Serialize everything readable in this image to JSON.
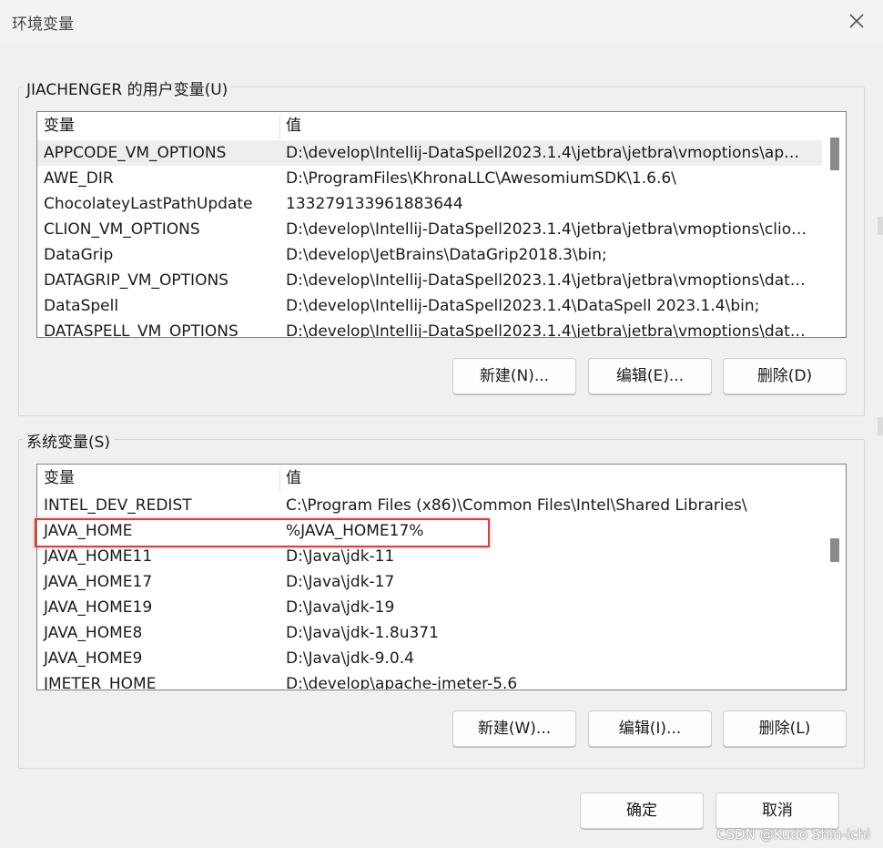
{
  "window": {
    "title": "环境变量"
  },
  "user_vars": {
    "label": "JIACHENGER 的用户变量(U)",
    "columns": {
      "name": "变量",
      "value": "值"
    },
    "rows": [
      {
        "name": "APPCODE_VM_OPTIONS",
        "value": "D:\\develop\\Intellij-DataSpell2023.1.4\\jetbra\\jetbra\\vmoptions\\ap…"
      },
      {
        "name": "AWE_DIR",
        "value": "D:\\ProgramFiles\\KhronaLLC\\AwesomiumSDK\\1.6.6\\"
      },
      {
        "name": "ChocolateyLastPathUpdate",
        "value": "133279133961883644"
      },
      {
        "name": "CLION_VM_OPTIONS",
        "value": "D:\\develop\\Intellij-DataSpell2023.1.4\\jetbra\\jetbra\\vmoptions\\clio…"
      },
      {
        "name": "DataGrip",
        "value": "D:\\develop\\JetBrains\\DataGrip2018.3\\bin;"
      },
      {
        "name": "DATAGRIP_VM_OPTIONS",
        "value": "D:\\develop\\Intellij-DataSpell2023.1.4\\jetbra\\jetbra\\vmoptions\\dat…"
      },
      {
        "name": "DataSpell",
        "value": "D:\\develop\\Intellij-DataSpell2023.1.4\\DataSpell 2023.1.4\\bin;"
      },
      {
        "name": "DATASPELL_VM_OPTIONS",
        "value": "D:\\develop\\Intellij-DataSpell2023.1.4\\jetbra\\jetbra\\vmoptions\\dat…"
      }
    ],
    "buttons": {
      "new": "新建(N)...",
      "edit": "编辑(E)...",
      "delete": "删除(D)"
    }
  },
  "system_vars": {
    "label": "系统变量(S)",
    "columns": {
      "name": "变量",
      "value": "值"
    },
    "rows": [
      {
        "name": "INTEL_DEV_REDIST",
        "value": "C:\\Program Files (x86)\\Common Files\\Intel\\Shared Libraries\\"
      },
      {
        "name": "JAVA_HOME",
        "value": "%JAVA_HOME17%"
      },
      {
        "name": "JAVA_HOME11",
        "value": "D:\\Java\\jdk-11"
      },
      {
        "name": "JAVA_HOME17",
        "value": "D:\\Java\\jdk-17"
      },
      {
        "name": "JAVA_HOME19",
        "value": "D:\\Java\\jdk-19"
      },
      {
        "name": "JAVA_HOME8",
        "value": "D:\\Java\\jdk-1.8u371"
      },
      {
        "name": "JAVA_HOME9",
        "value": "D:\\Java\\jdk-9.0.4"
      },
      {
        "name": "JMETER_HOME",
        "value": "D:\\develop\\apache-jmeter-5.6"
      }
    ],
    "buttons": {
      "new": "新建(W)...",
      "edit": "编辑(I)...",
      "delete": "删除(L)"
    }
  },
  "footer": {
    "ok": "确定",
    "cancel": "取消"
  },
  "watermark": "CSDN @Kudō Shin-ichi",
  "colors": {
    "highlight": "#e53935",
    "background": "#f0f0f0"
  }
}
